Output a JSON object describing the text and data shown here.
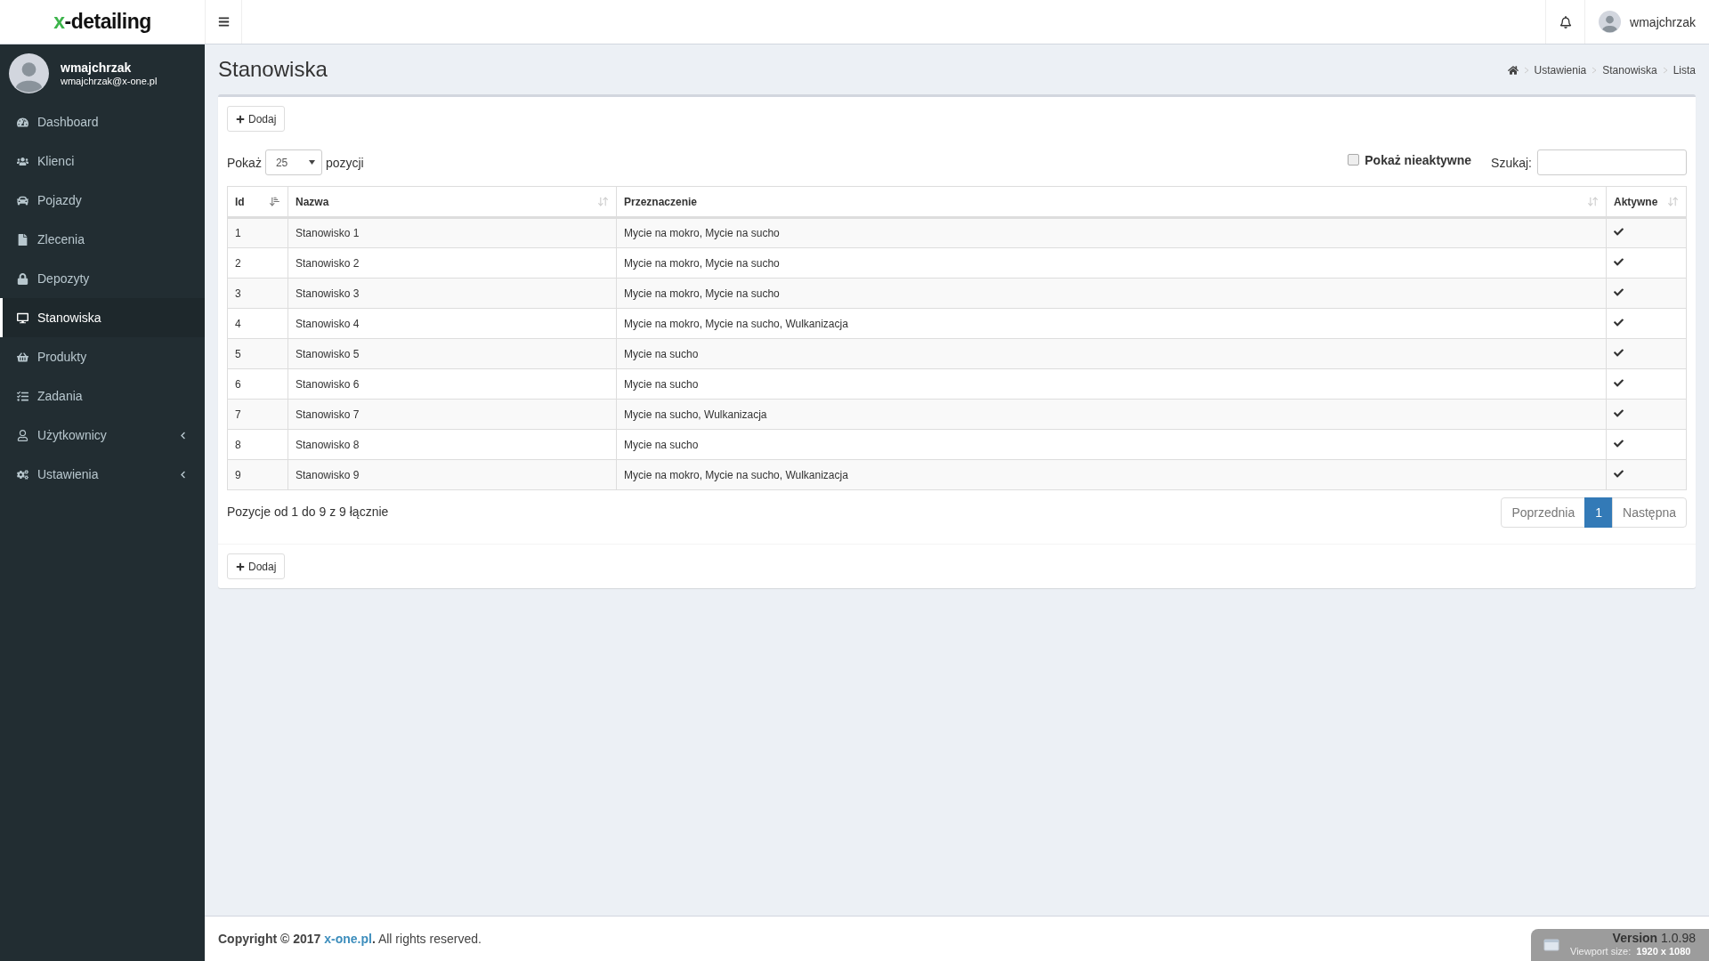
{
  "header": {
    "logo_accent": "x",
    "logo_rest": "-detailing",
    "user_name": "wmajchrzak"
  },
  "sidebar": {
    "user": {
      "name": "wmajchrzak",
      "email": "wmajchrzak@x-one.pl"
    },
    "items": [
      {
        "label": "Dashboard",
        "selected": false,
        "has_submenu": false
      },
      {
        "label": "Klienci",
        "selected": false,
        "has_submenu": false
      },
      {
        "label": "Pojazdy",
        "selected": false,
        "has_submenu": false
      },
      {
        "label": "Zlecenia",
        "selected": false,
        "has_submenu": false
      },
      {
        "label": "Depozyty",
        "selected": false,
        "has_submenu": false
      },
      {
        "label": "Stanowiska",
        "selected": true,
        "has_submenu": false
      },
      {
        "label": "Produkty",
        "selected": false,
        "has_submenu": false
      },
      {
        "label": "Zadania",
        "selected": false,
        "has_submenu": false
      },
      {
        "label": "Użytkownicy",
        "selected": false,
        "has_submenu": true
      },
      {
        "label": "Ustawienia",
        "selected": false,
        "has_submenu": true
      }
    ]
  },
  "page": {
    "title": "Stanowiska",
    "breadcrumb": [
      "Ustawienia",
      "Stanowiska",
      "Lista"
    ]
  },
  "box": {
    "add_button": "Dodaj",
    "length": {
      "label_before": "Pokaż",
      "value": "25",
      "label_after": "pozycji"
    },
    "inactive_toggle": {
      "label": "Pokaż nieaktywne",
      "checked": false
    },
    "search": {
      "label": "Szukaj:"
    },
    "table": {
      "columns": [
        {
          "label": "Id",
          "sorted": true
        },
        {
          "label": "Nazwa",
          "sorted": false
        },
        {
          "label": "Przeznaczenie",
          "sorted": false
        },
        {
          "label": "Aktywne",
          "sorted": false
        }
      ],
      "rows": [
        {
          "id": "1",
          "name": "Stanowisko 1",
          "purpose": "Mycie na mokro, Mycie na sucho",
          "active": true
        },
        {
          "id": "2",
          "name": "Stanowisko 2",
          "purpose": "Mycie na mokro, Mycie na sucho",
          "active": true
        },
        {
          "id": "3",
          "name": "Stanowisko 3",
          "purpose": "Mycie na mokro, Mycie na sucho",
          "active": true
        },
        {
          "id": "4",
          "name": "Stanowisko 4",
          "purpose": "Mycie na mokro, Mycie na sucho, Wulkanizacja",
          "active": true
        },
        {
          "id": "5",
          "name": "Stanowisko 5",
          "purpose": "Mycie na sucho",
          "active": true
        },
        {
          "id": "6",
          "name": "Stanowisko 6",
          "purpose": "Mycie na sucho",
          "active": true
        },
        {
          "id": "7",
          "name": "Stanowisko 7",
          "purpose": "Mycie na sucho, Wulkanizacja",
          "active": true
        },
        {
          "id": "8",
          "name": "Stanowisko 8",
          "purpose": "Mycie na sucho",
          "active": true
        },
        {
          "id": "9",
          "name": "Stanowisko 9",
          "purpose": "Mycie na mokro, Mycie na sucho, Wulkanizacja",
          "active": true
        }
      ]
    },
    "info": "Pozycje od 1 do 9 z 9 łącznie",
    "pagination": {
      "previous": "Poprzednia",
      "pages": [
        {
          "label": "1",
          "selected": true
        }
      ],
      "next": "Następna"
    },
    "footer_button": "Dodaj"
  },
  "footer": {
    "copyright": "Copyright © 2017",
    "link": "x-one.pl",
    "tail": "**.** All rights reserved.",
    "version": "**Version** 1.0.98"
  },
  "viewport_overlay": {
    "label": "Viewport size:",
    "value": "1920 x 1080"
  }
}
